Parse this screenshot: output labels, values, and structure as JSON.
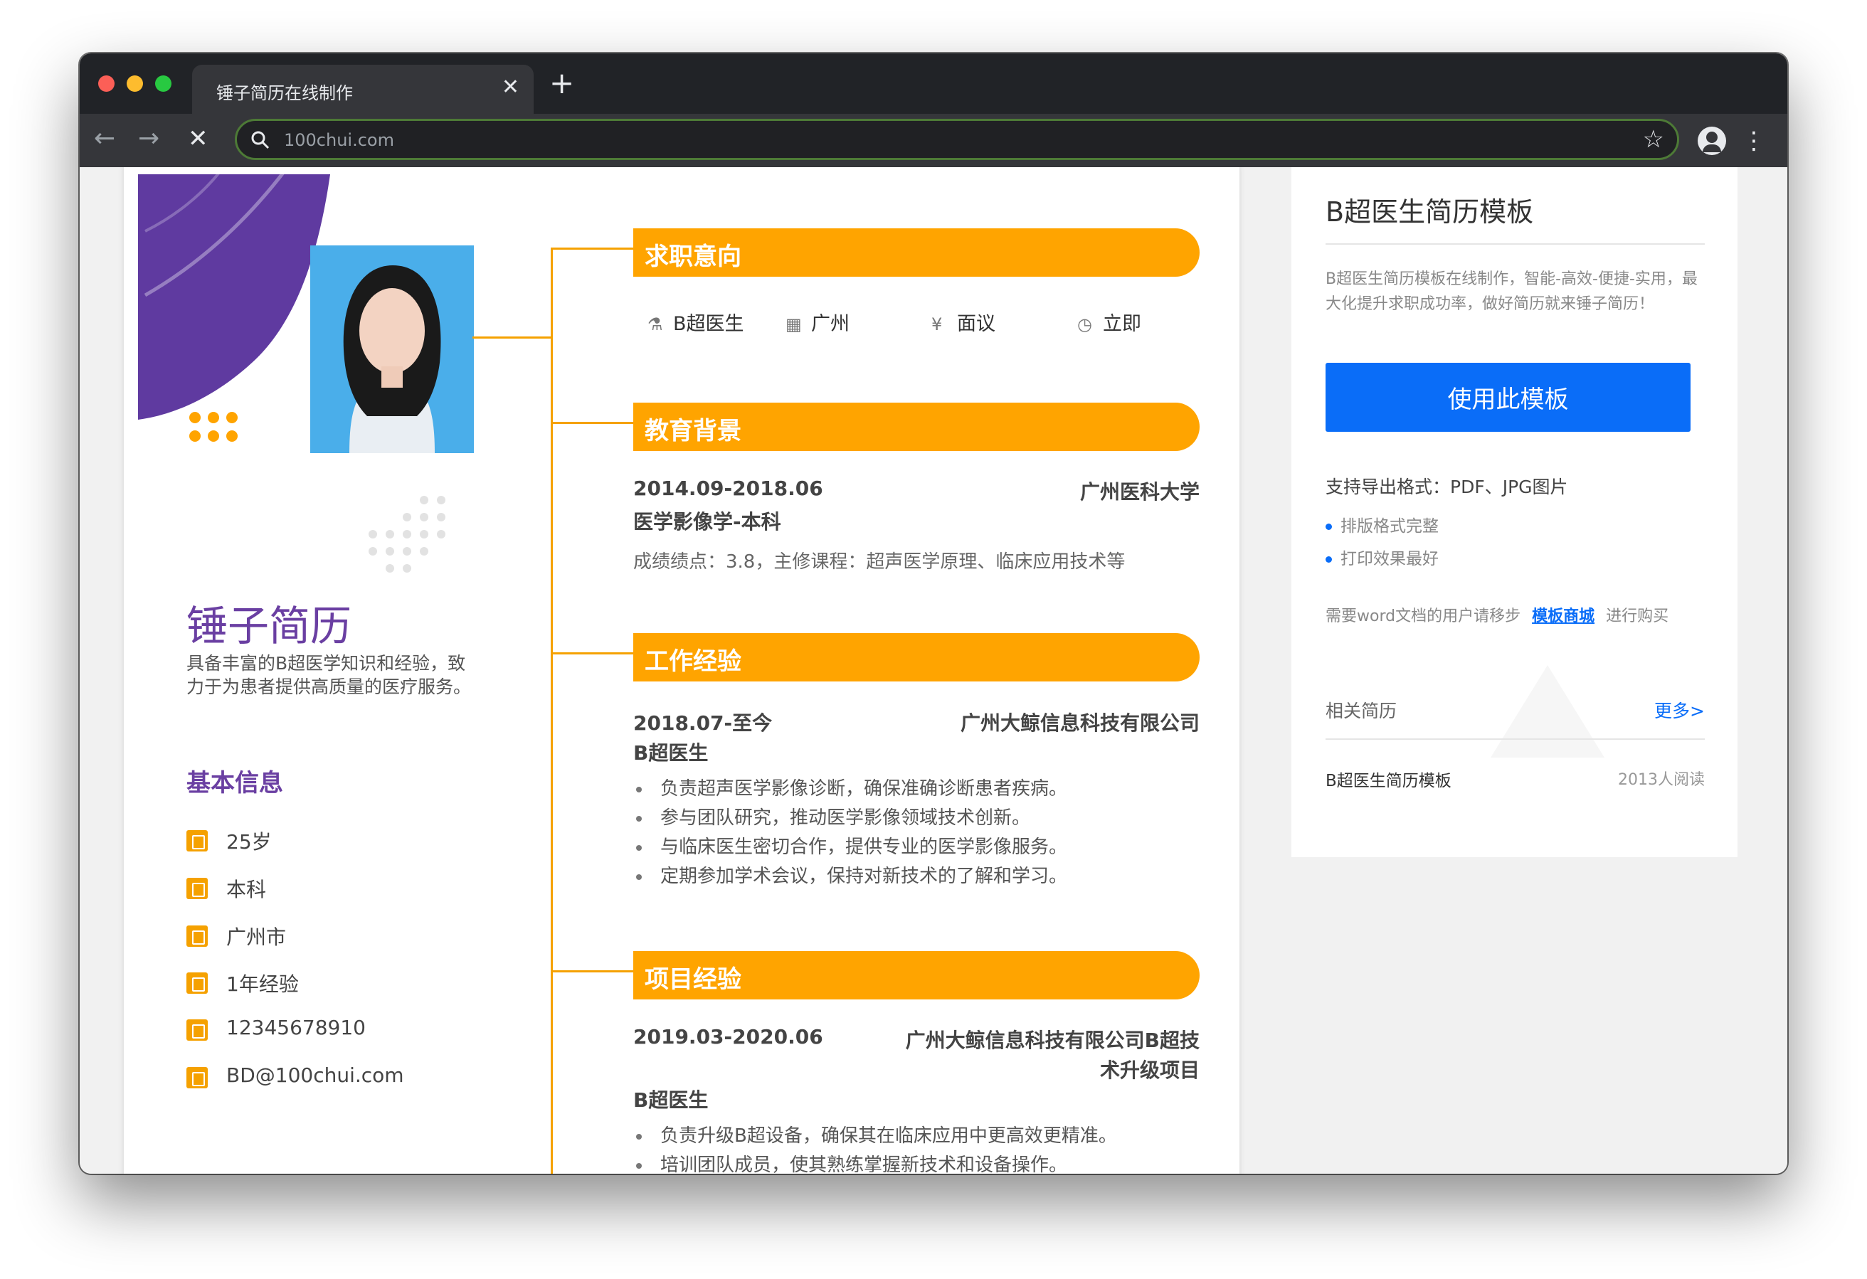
{
  "browser": {
    "tab_title": "锤子简历在线制作",
    "tab_close": "✕",
    "new_tab": "+",
    "url": "100chui.com",
    "nav_back": "←",
    "nav_forward": "→",
    "nav_stop": "✕",
    "star": "☆",
    "menu": "⋮"
  },
  "resume": {
    "name": "锤子简历",
    "intro": "具备丰富的B超医学知识和经验，致力于为患者提供高质量的医疗服务。",
    "basic_title": "基本信息",
    "basic_info": [
      {
        "icon": "calendar-icon",
        "text": "25岁"
      },
      {
        "icon": "graduation-cap-icon",
        "text": "本科"
      },
      {
        "icon": "building-icon",
        "text": "广州市"
      },
      {
        "icon": "document-icon",
        "text": "1年经验"
      },
      {
        "icon": "phone-icon",
        "text": "12345678910"
      },
      {
        "icon": "mail-icon",
        "text": "BD@100chui.com"
      }
    ],
    "sections": {
      "intent": {
        "title": "求职意向",
        "items": [
          {
            "icon": "flask-icon",
            "glyph": "⚗",
            "text": "B超医生"
          },
          {
            "icon": "building-icon",
            "glyph": "▦",
            "text": "广州"
          },
          {
            "icon": "yen-icon",
            "glyph": "¥",
            "text": "面议"
          },
          {
            "icon": "clock-icon",
            "glyph": "◷",
            "text": "立即"
          }
        ]
      },
      "education": {
        "title": "教育背景",
        "date": "2014.09-2018.06",
        "school": "广州医科大学",
        "major": "医学影像学-本科",
        "detail": "成绩绩点：3.8，主修课程：超声医学原理、临床应用技术等"
      },
      "work": {
        "title": "工作经验",
        "date": "2018.07-至今",
        "company": "广州大鲸信息科技有限公司",
        "role": "B超医生",
        "bullets": [
          "负责超声医学影像诊断，确保准确诊断患者疾病。",
          "参与团队研究，推动医学影像领域技术创新。",
          "与临床医生密切合作，提供专业的医学影像服务。",
          "定期参加学术会议，保持对新技术的了解和学习。"
        ]
      },
      "project": {
        "title": "项目经验",
        "date": "2019.03-2020.06",
        "name_line1": "广州大鲸信息科技有限公司B超技",
        "name_line2": "术升级项目",
        "role": "B超医生",
        "bullets": [
          "负责升级B超设备，确保其在临床应用中更高效更精准。",
          "培训团队成员，使其熟练掌握新技术和设备操作。"
        ]
      }
    }
  },
  "side": {
    "title": "B超医生简历模板",
    "desc": "B超医生简历模板在线制作，智能-高效-便捷-实用，最大化提升求职成功率，做好简历就来锤子简历！",
    "use_button": "使用此模板",
    "formats": "支持导出格式：PDF、JPG图片",
    "features": [
      "排版格式完整",
      "打印效果最好"
    ],
    "note_before": "需要word文档的用户请移步",
    "note_link": "模板商城",
    "note_after": "进行购买",
    "related_title": "相关简历",
    "more": "更多>",
    "related_item": {
      "name": "B超医生简历模板",
      "count": "2013人阅读"
    }
  },
  "colors": {
    "accent_orange": "#ffa400",
    "purple": "#6a3fa2",
    "button_blue": "#0a6df8",
    "chrome_dark": "#212327"
  }
}
